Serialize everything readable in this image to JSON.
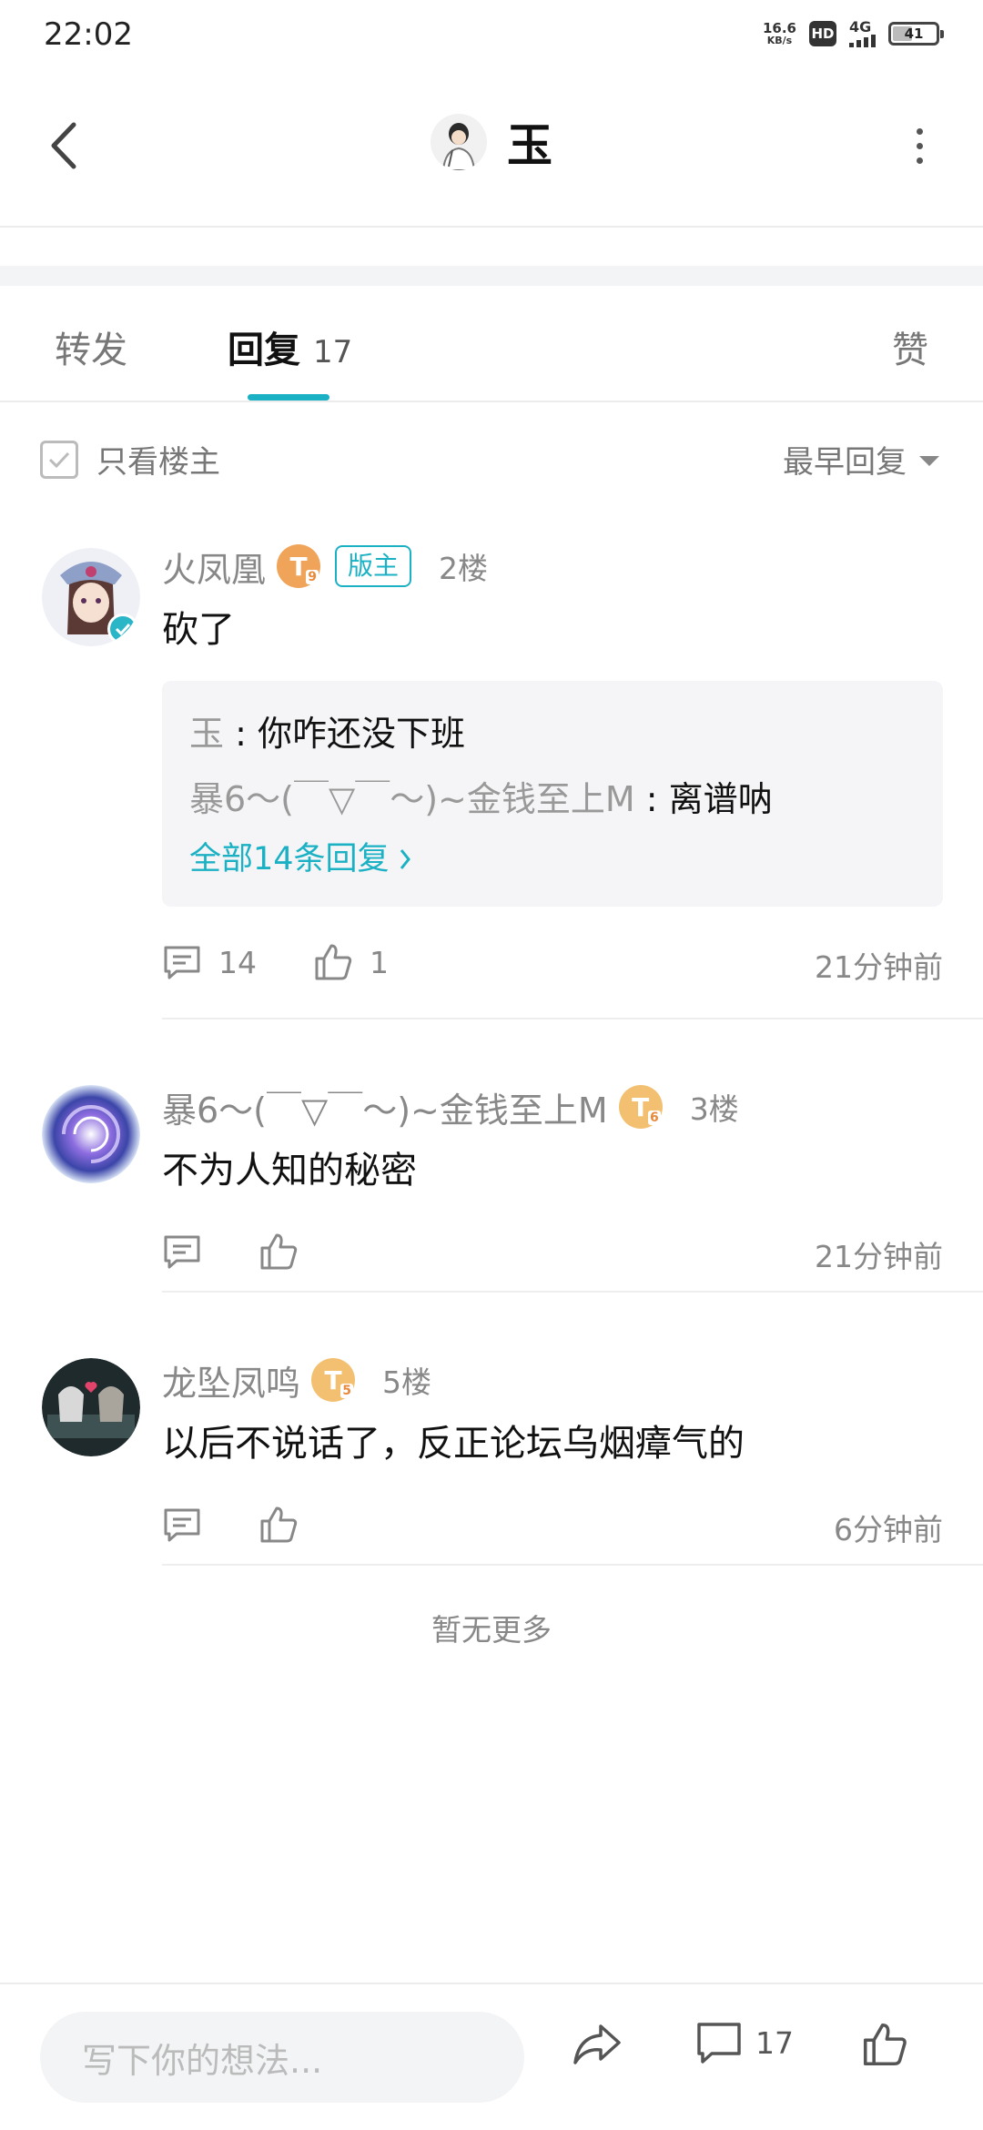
{
  "status_bar": {
    "time": "22:02",
    "net_speed_value": "16.6",
    "net_speed_unit": "KB/s",
    "hd": "HD",
    "network": "4G",
    "battery": "41",
    "battery_level": 0.41
  },
  "header": {
    "title": "玉",
    "back_icon": "chevron-left-icon",
    "more_icon": "more-vertical-icon"
  },
  "tabs": {
    "forward": "转发",
    "reply": "回复",
    "reply_count": "17",
    "like": "赞"
  },
  "filter": {
    "only_owner": "只看楼主",
    "sort": "最早回复"
  },
  "comments": [
    {
      "name": "火凤凰",
      "level": "T",
      "level_sub": "9",
      "badge": "版主",
      "floor": "2楼",
      "text": "砍了",
      "sub_replies": [
        {
          "author": "玉",
          "sep": " : ",
          "text": "你咋还没下班"
        },
        {
          "author": "暴6〜(￣▽￣〜)~金钱至上M",
          "sep": " : ",
          "text": "离谱呐"
        }
      ],
      "all_replies": "全部14条回复",
      "comment_count": "14",
      "like_count": "1",
      "time": "21分钟前"
    },
    {
      "name": "暴6〜(￣▽￣〜)~金钱至上M",
      "level": "T",
      "level_sub": "6",
      "floor": "3楼",
      "text": "不为人知的秘密",
      "time": "21分钟前"
    },
    {
      "name": "龙坠凤鸣",
      "level": "T",
      "level_sub": "5",
      "floor": "5楼",
      "text": "以后不说话了，反正论坛乌烟瘴气的",
      "time": "6分钟前"
    }
  ],
  "no_more": "暂无更多",
  "bottom_bar": {
    "placeholder": "写下你的想法...",
    "comment_count": "17"
  },
  "colors": {
    "accent": "#1bb1c4",
    "level_orange": "#f0a45a",
    "level_gold": "#f2c070"
  }
}
